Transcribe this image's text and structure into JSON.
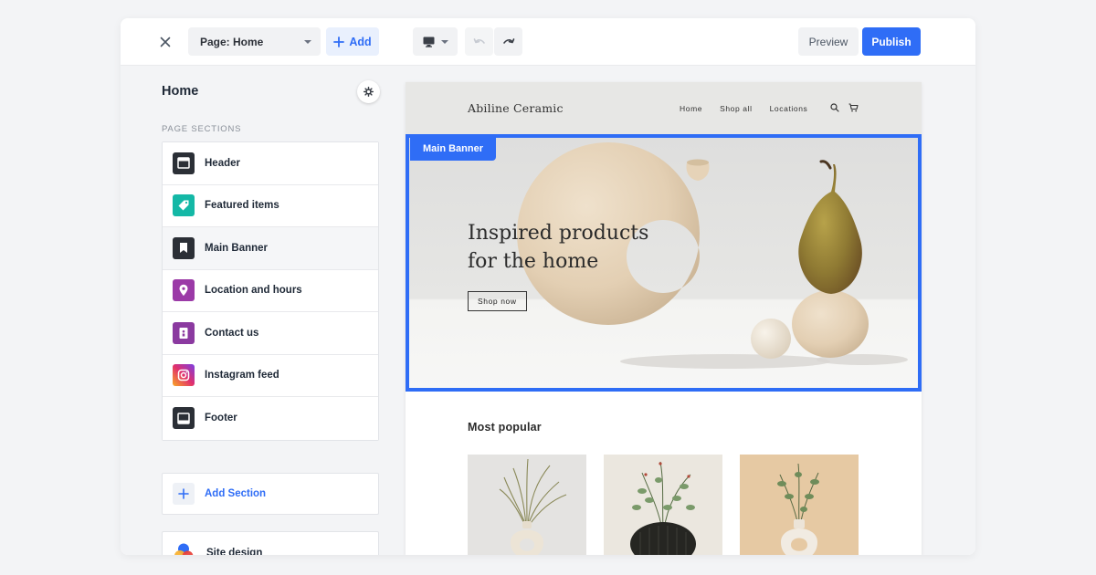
{
  "topbar": {
    "page_select": "Page: Home",
    "add_label": "Add",
    "preview_label": "Preview",
    "publish_label": "Publish"
  },
  "sidebar": {
    "title": "Home",
    "section_label": "PAGE SECTIONS",
    "sections": [
      {
        "label": "Header",
        "icon": "header-layout-icon",
        "color": "#2b2f36"
      },
      {
        "label": "Featured items",
        "icon": "tag-icon",
        "color": "#14b8a6"
      },
      {
        "label": "Main Banner",
        "icon": "bookmark-icon",
        "color": "#2b2f36",
        "active": true
      },
      {
        "label": "Location and hours",
        "icon": "map-pin-icon",
        "color": "#9b3aa7"
      },
      {
        "label": "Contact us",
        "icon": "contact-card-icon",
        "color": "#8b3aa0"
      },
      {
        "label": "Instagram feed",
        "icon": "instagram-icon",
        "color": "#e1306c"
      },
      {
        "label": "Footer",
        "icon": "footer-layout-icon",
        "color": "#2b2f36"
      }
    ],
    "add_section_label": "Add Section",
    "site_design_label": "Site design"
  },
  "site": {
    "logo": "Abiline Ceramic",
    "nav": [
      "Home",
      "Shop all",
      "Locations"
    ],
    "banner_tag": "Main Banner",
    "headline_line1": "Inspired products",
    "headline_line2": "for the home",
    "shop_button": "Shop now",
    "popular_title": "Most popular"
  },
  "colors": {
    "accent": "#2f6df6",
    "background": "#f3f4f6"
  }
}
